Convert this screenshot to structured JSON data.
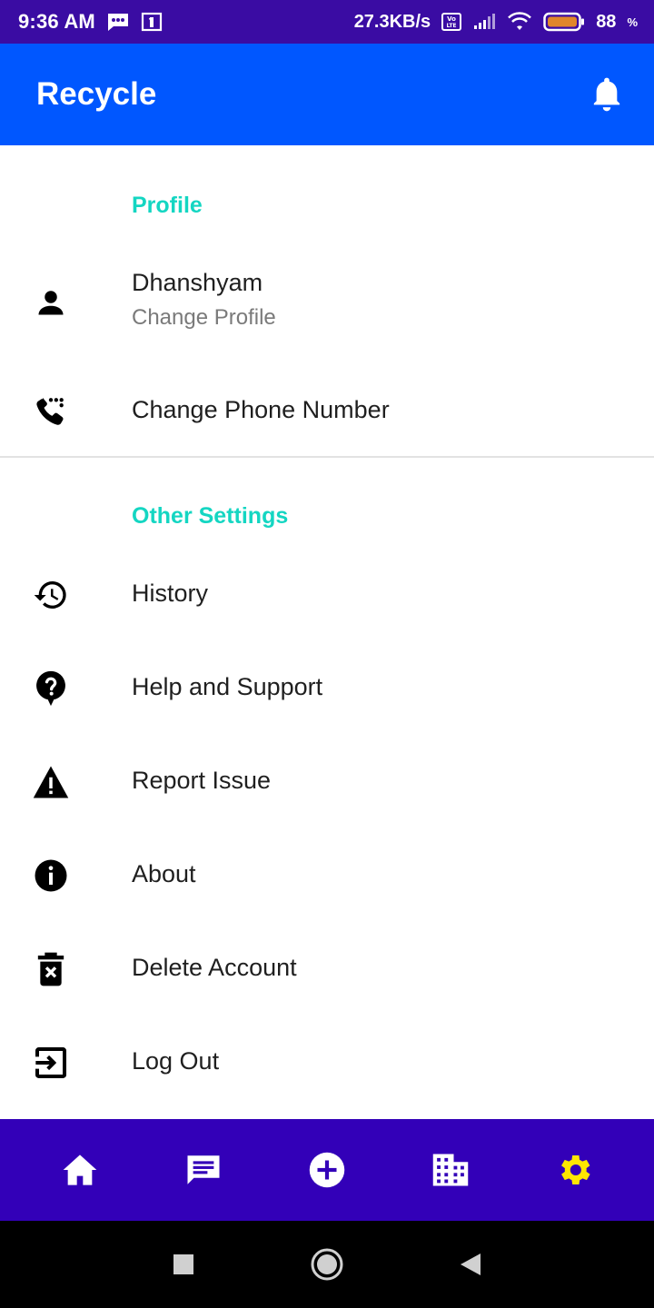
{
  "status_bar": {
    "time": "9:36 AM",
    "net_speed": "27.3KB/s",
    "volte": "VoLTE",
    "battery_percent": "88",
    "percent_sign": "%"
  },
  "app_bar": {
    "title": "Recycle",
    "bell_icon": "notifications-icon"
  },
  "profile_section": {
    "header": "Profile",
    "user_name": "Dhanshyam",
    "change_profile": "Change Profile",
    "change_phone": "Change Phone Number"
  },
  "other_section": {
    "header": "Other Settings",
    "items": [
      {
        "label": "History",
        "icon": "history-icon"
      },
      {
        "label": "Help and Support",
        "icon": "help-icon"
      },
      {
        "label": "Report Issue",
        "icon": "warning-icon"
      },
      {
        "label": "About",
        "icon": "info-icon"
      },
      {
        "label": "Delete Account",
        "icon": "delete-icon"
      },
      {
        "label": "Log Out",
        "icon": "logout-icon"
      }
    ]
  },
  "bottom_nav": {
    "items": [
      "home-icon",
      "chat-icon",
      "add-icon",
      "building-icon",
      "settings-icon"
    ],
    "active": "settings-icon"
  },
  "colors": {
    "status_bar": "#3a0ca3",
    "app_bar": "#0057ff",
    "accent": "#14d6c2",
    "bottom_nav": "#3300b8",
    "active_nav": "#ffe600"
  }
}
